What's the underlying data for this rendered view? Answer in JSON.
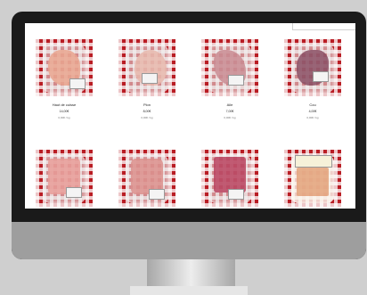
{
  "products": [
    {
      "name": "Haut de cuisse",
      "price": "14,00€",
      "unit": "0,00€ / kg",
      "meat_color": "#e9a48e"
    },
    {
      "name": "Plon",
      "price": "8,00€",
      "unit": "0,00€ / kg",
      "meat_color": "#e7b9ad"
    },
    {
      "name": "Aile",
      "price": "7,00€",
      "unit": "0,00€ / kg",
      "meat_color": "#c98b92"
    },
    {
      "name": "Cou",
      "price": "4,00€",
      "unit": "0,00€ / kg",
      "meat_color": "#8a4d63"
    },
    {
      "name": "",
      "price": "",
      "unit": "",
      "meat_color": "#e79b97"
    },
    {
      "name": "",
      "price": "",
      "unit": "",
      "meat_color": "#dc8f8c"
    },
    {
      "name": "",
      "price": "",
      "unit": "",
      "meat_color": "#b9425e"
    },
    {
      "name": "",
      "price": "",
      "unit": "",
      "meat_color": "#e3a27a"
    }
  ],
  "colors": {
    "bezel": "#1a1a1a",
    "chin": "#9e9e9e",
    "background": "#cfcfcf",
    "tablecloth_red": "#b91d24"
  }
}
